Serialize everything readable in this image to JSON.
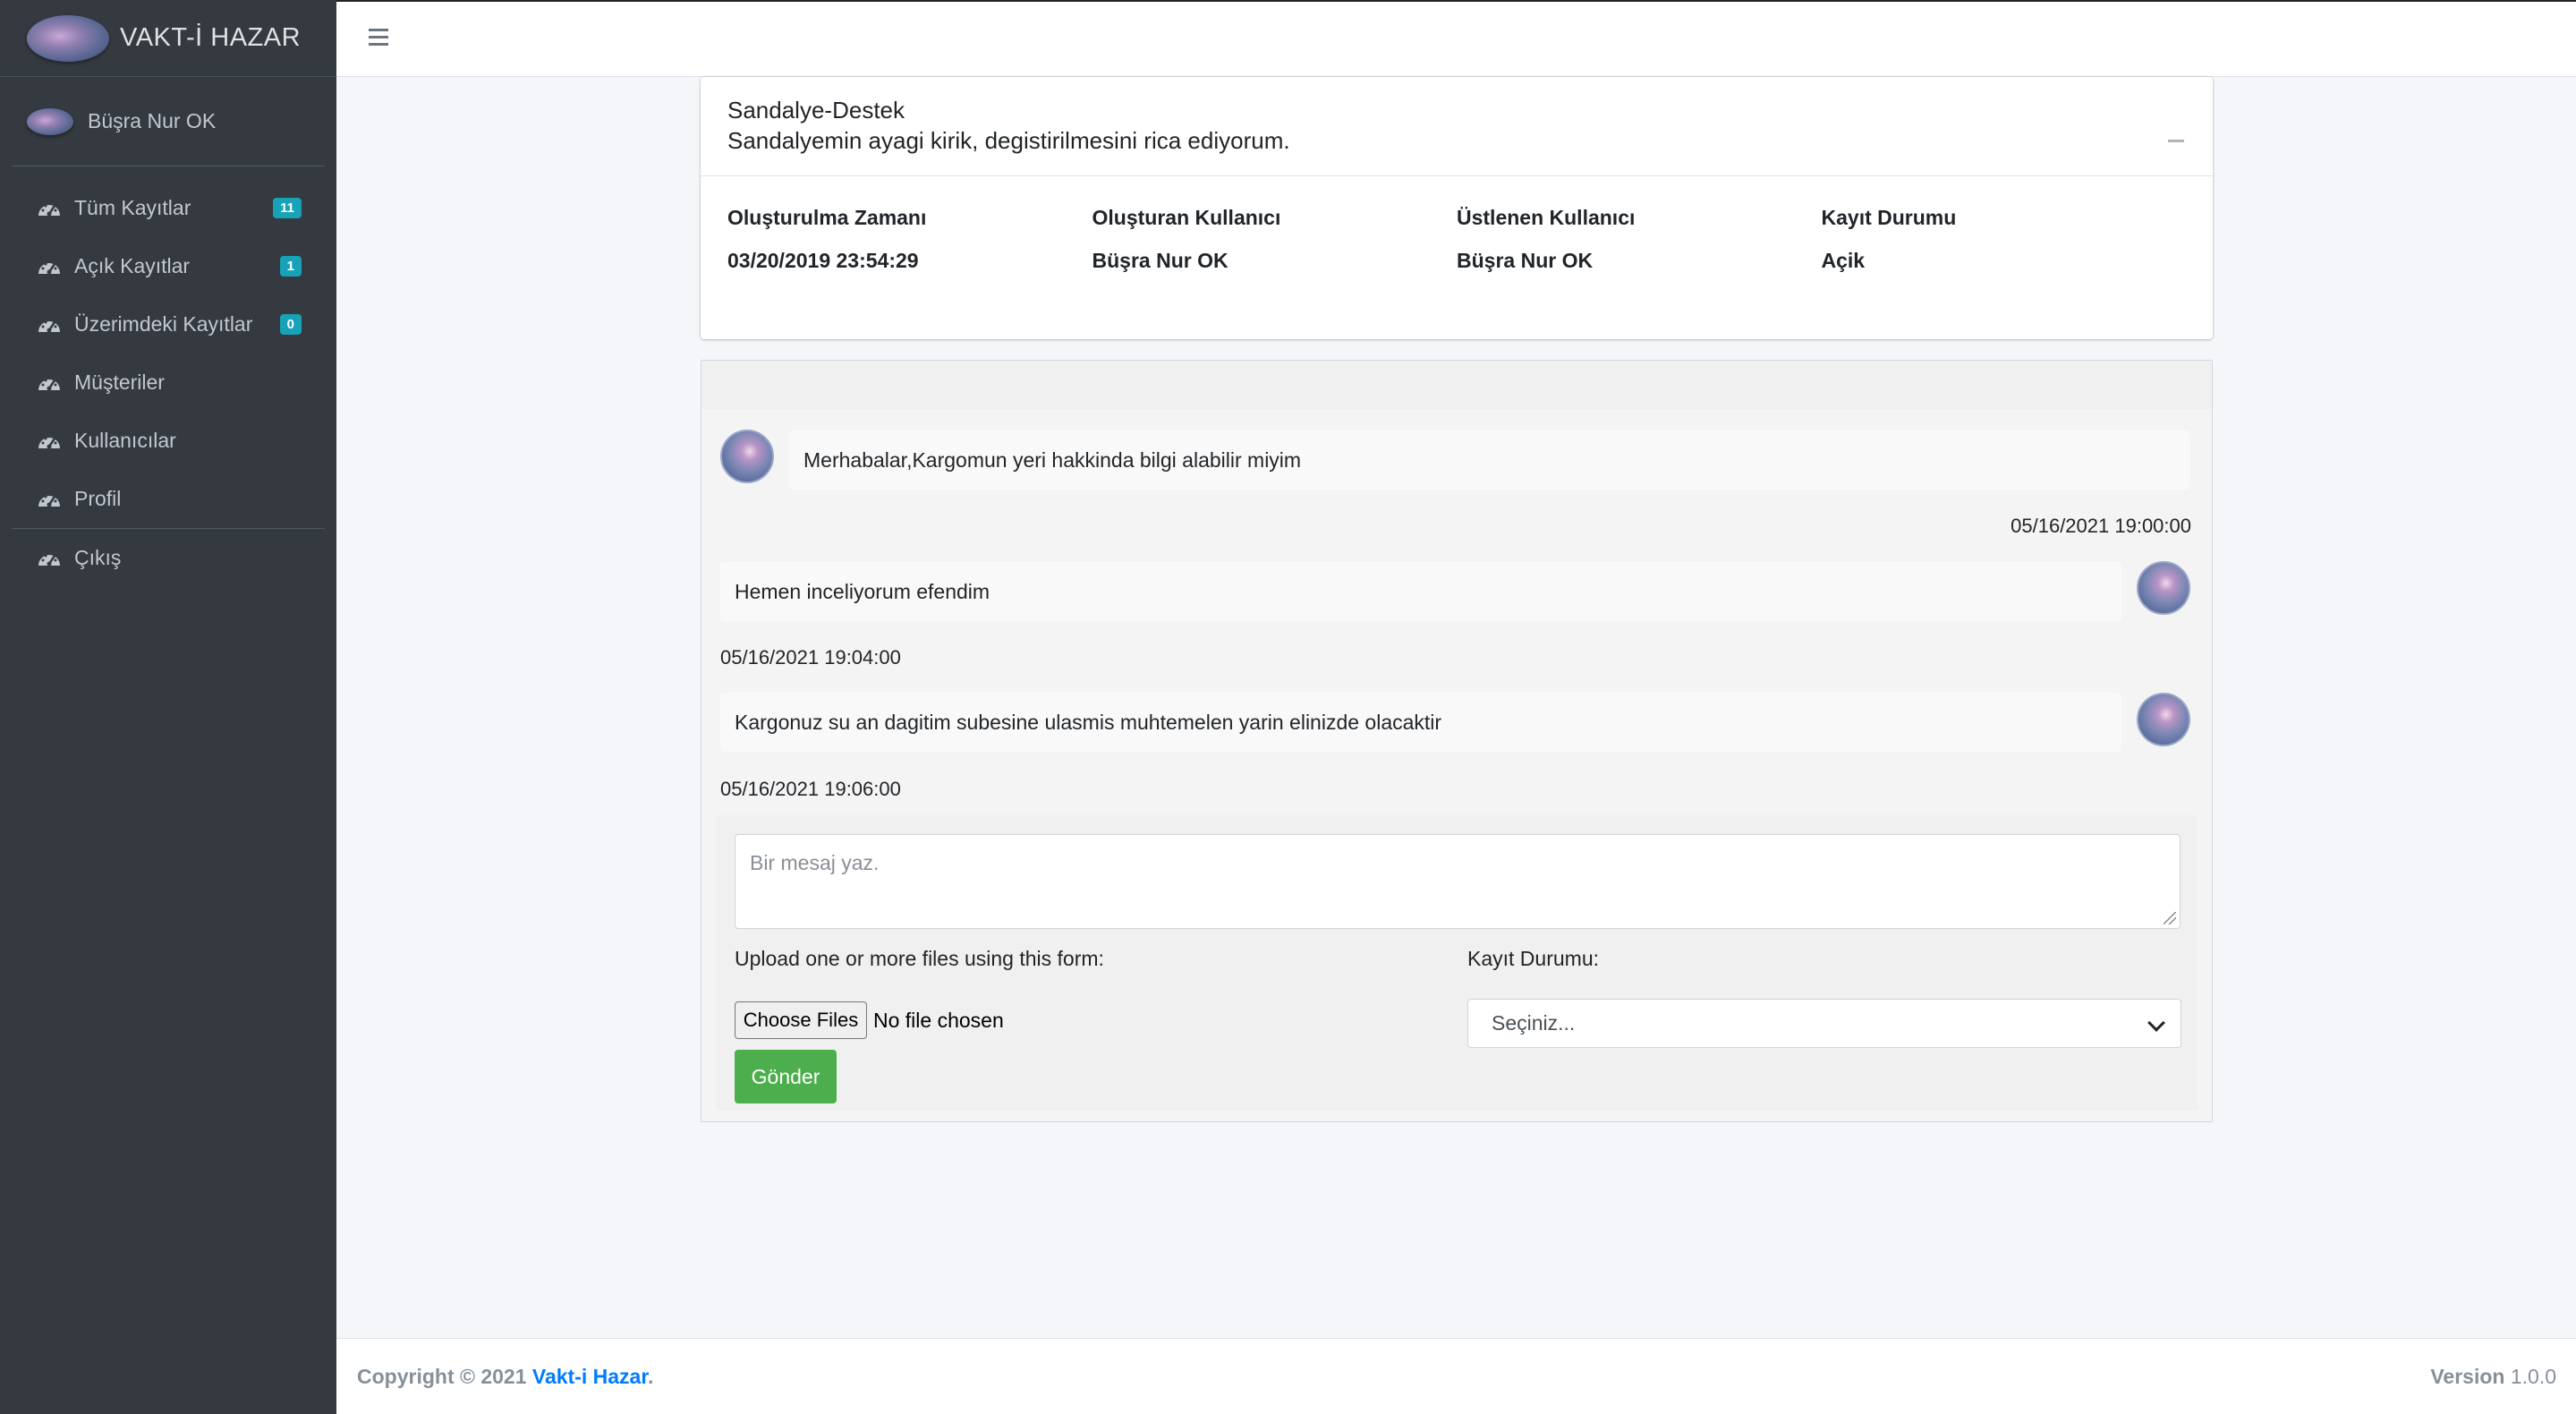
{
  "brand": {
    "name": "VAKT-İ HAZAR"
  },
  "user": {
    "name": "Büşra Nur OK"
  },
  "nav": {
    "items": [
      {
        "label": "Tüm Kayıtlar",
        "badge": "11",
        "icon": "dashboard-gauge-icon"
      },
      {
        "label": "Açık Kayıtlar",
        "badge": "1",
        "icon": "dashboard-gauge-icon"
      },
      {
        "label": "Üzerimdeki Kayıtlar",
        "badge": "0",
        "icon": "dashboard-gauge-icon"
      },
      {
        "label": "Müşteriler",
        "icon": "dashboard-gauge-icon"
      },
      {
        "label": "Kullanıcılar",
        "icon": "dashboard-gauge-icon"
      },
      {
        "label": "Profil",
        "icon": "dashboard-gauge-icon"
      },
      {
        "label": "Çıkış",
        "icon": "dashboard-gauge-icon"
      }
    ]
  },
  "ticket": {
    "title": "Sandalye-Destek",
    "description": "Sandalyemin ayagi kirik, degistirilmesini rica ediyorum.",
    "columns": [
      {
        "label": "Oluşturulma Zamanı",
        "value": "03/20/2019 23:54:29"
      },
      {
        "label": "Oluşturan Kullanıcı",
        "value": "Büşra Nur OK"
      },
      {
        "label": "Üstlenen Kullanıcı",
        "value": "Büşra Nur OK"
      },
      {
        "label": "Kayıt Durumu",
        "value": "Açik"
      }
    ]
  },
  "messages": [
    {
      "text": "Merhabalar,Kargomun yeri hakkinda bilgi alabilir miyim",
      "time": "05/16/2021 19:00:00"
    },
    {
      "text": "Hemen inceliyorum efendim",
      "time": "05/16/2021 19:04:00"
    },
    {
      "text": "Kargonuz su an dagitim subesine ulasmis muhtemelen yarin elinizde olacaktir",
      "time": "05/16/2021 19:06:00"
    }
  ],
  "compose": {
    "placeholder": "Bir mesaj yaz.",
    "upload_label": "Upload one or more files using this form:",
    "choose_files": "Choose Files",
    "no_file": "No file chosen",
    "status_label": "Kayıt Durumu:",
    "status_selected": "Seçiniz...",
    "send": "Gönder"
  },
  "footer": {
    "copyright": "Copyright © 2021",
    "link": "Vakt-i Hazar",
    "version_label": "Version",
    "version": "1.0.0"
  },
  "colors": {
    "sidebar": "#343a40",
    "badge": "#17a2b8",
    "send": "#4cae4c",
    "link": "#007bff"
  }
}
